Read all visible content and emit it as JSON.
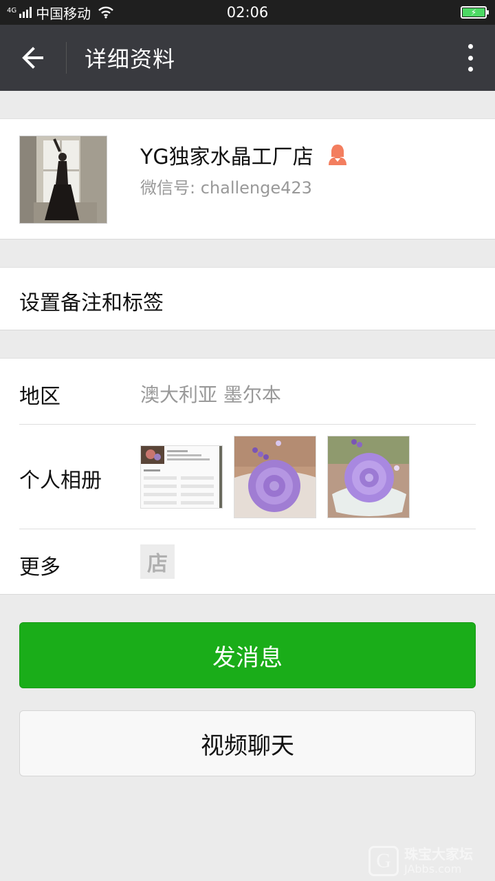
{
  "status_bar": {
    "network_type": "4G",
    "carrier": "中国移动",
    "time": "02:06"
  },
  "app_bar": {
    "title": "详细资料"
  },
  "profile": {
    "nickname": "YG独家水晶工厂店",
    "wechat_id": "微信号: challenge423",
    "gender": "female"
  },
  "remark": {
    "label": "设置备注和标签"
  },
  "info": {
    "region_label": "地区",
    "region_value": "澳大利亚  墨尔本",
    "album_label": "个人相册",
    "more_label": "更多",
    "store_icon_char": "店"
  },
  "actions": {
    "send_message": "发消息",
    "video_chat": "视频聊天"
  },
  "watermark": {
    "cn": "珠宝大家坛",
    "en": "JAbbs.com"
  },
  "colors": {
    "app_bar": "#393a3f",
    "primary_green": "#1aad19",
    "female_icon": "#f37e5f"
  }
}
